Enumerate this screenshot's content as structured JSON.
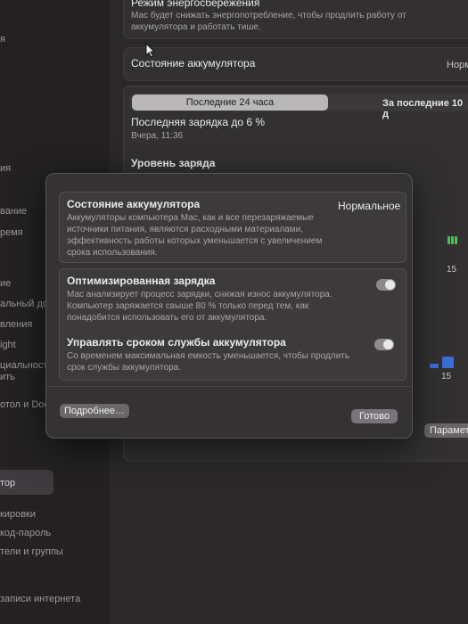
{
  "sidebar": {
    "items": [
      "я",
      "ия",
      "вание",
      "ремя",
      "ие",
      "альный дос",
      "вления",
      "ight",
      "циальность",
      "ить",
      "отол и Doc",
      "тор",
      "кировки",
      "код-пароль",
      "тели и группы",
      "записи интернета"
    ]
  },
  "power_mode": {
    "title": "Режим энергосбережения",
    "description": "Мас будет снижать энергопотребление, чтобы продлить работу от аккумулятора и работать тише."
  },
  "battery_health_row": {
    "label": "Состояние аккумулятора",
    "value": "Норм"
  },
  "usage": {
    "tabs": [
      "Последние 24 часа",
      "За последние 10 д"
    ],
    "last_charge_title": "Последняя зарядка до 6 %",
    "last_charge_time": "Вчера, 11:36",
    "level_heading": "Уровень заряда",
    "tick_a": "15",
    "tick_b": "15",
    "params_button": "Парамет"
  },
  "dialog": {
    "health": {
      "title": "Состояние аккумулятора",
      "status": "Нормальное",
      "description": "Аккумуляторы компьютера Мас, как и все перезаряжаемые источники питания, являются расходными материалами, эффективность работы которых уменьшается с увеличением срока использования."
    },
    "optimized": {
      "title": "Оптимизированная зарядка",
      "description": "Мас анализирует процесс зарядки, снижая износ аккумулятора. Компьютер заряжается свыше 80 % только перед тем, как понадобится использовать его от аккумулятора.",
      "enabled": true
    },
    "manage": {
      "title": "Управлять сроком службы аккумулятора",
      "description": "Со временем максимальная емкость уменьшается, чтобы продлить срок службы аккумулятора.",
      "enabled": true
    },
    "more_button": "Подробнее…",
    "done_button": "Готово"
  },
  "colors": {
    "accent_blue": "#3a6fd8",
    "charge_green": "#4ac456"
  }
}
